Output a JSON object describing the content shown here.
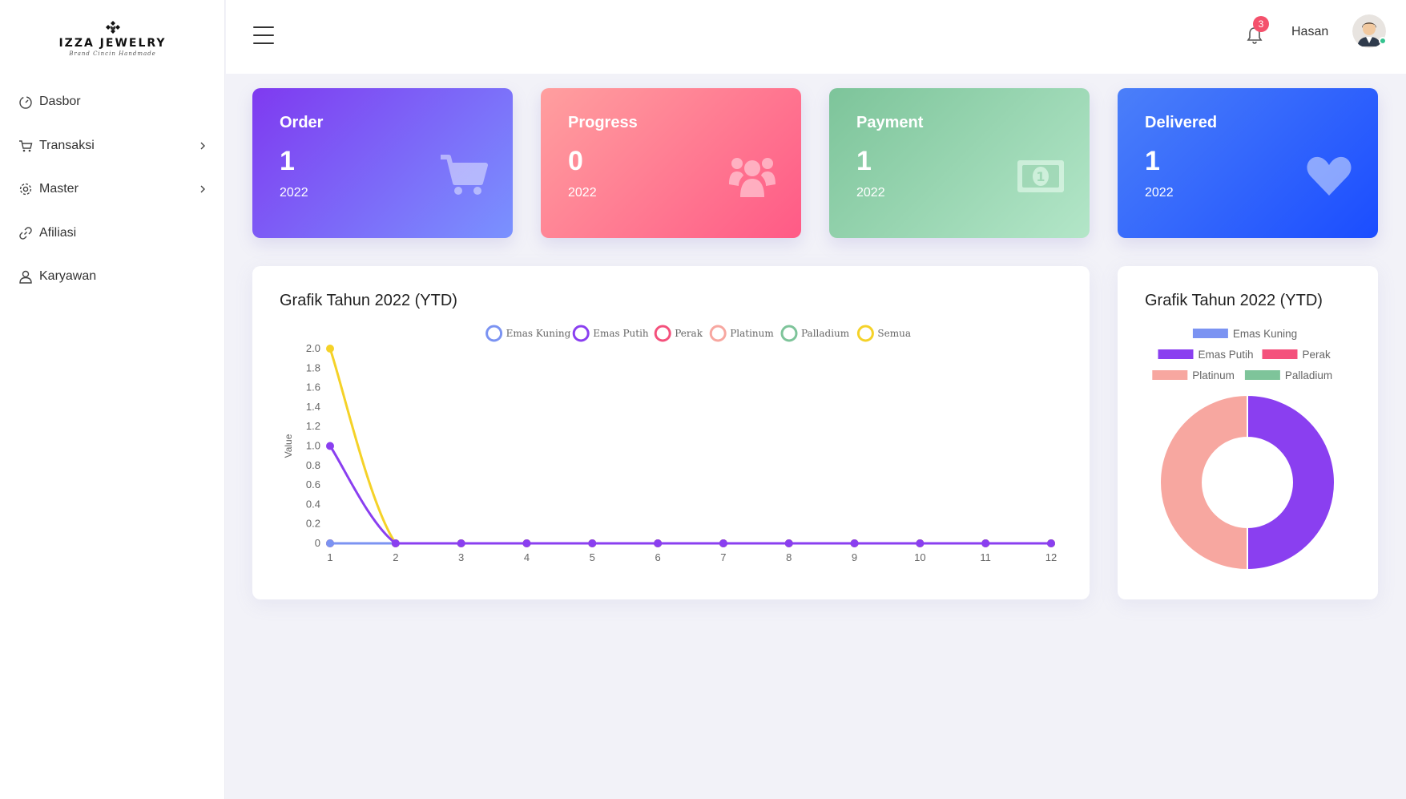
{
  "brand": {
    "name": "IZZA JEWELRY",
    "tagline": "Brand Cincin Handmade"
  },
  "sidebar": {
    "items": [
      {
        "label": "Dasbor",
        "icon": "dashboard-icon",
        "has_submenu": false
      },
      {
        "label": "Transaksi",
        "icon": "cart-icon",
        "has_submenu": true
      },
      {
        "label": "Master",
        "icon": "gear-icon",
        "has_submenu": true
      },
      {
        "label": "Afiliasi",
        "icon": "link-icon",
        "has_submenu": false
      },
      {
        "label": "Karyawan",
        "icon": "user-icon",
        "has_submenu": false
      }
    ]
  },
  "header": {
    "notification_count": "3",
    "username": "Hasan"
  },
  "cards": [
    {
      "title": "Order",
      "value": "1",
      "year": "2022",
      "icon": "cart-icon",
      "color_from": "#7f3af0",
      "color_to": "#7a92ff"
    },
    {
      "title": "Progress",
      "value": "0",
      "year": "2022",
      "icon": "users-icon",
      "color_from": "#ff9f9f",
      "color_to": "#ff5a86"
    },
    {
      "title": "Payment",
      "value": "1",
      "year": "2022",
      "icon": "money-icon",
      "color_from": "#7dc49a",
      "color_to": "#b3e6c8"
    },
    {
      "title": "Delivered",
      "value": "1",
      "year": "2022",
      "icon": "heart-icon",
      "color_from": "#4b7ff9",
      "color_to": "#1b4dff"
    }
  ],
  "line_panel": {
    "title": "Grafik Tahun 2022 (YTD)"
  },
  "donut_panel": {
    "title": "Grafik Tahun 2022 (YTD)"
  },
  "chart_data": [
    {
      "type": "line",
      "title": "Grafik Tahun 2022 (YTD)",
      "xlabel": "",
      "ylabel": "Value",
      "x": [
        1,
        2,
        3,
        4,
        5,
        6,
        7,
        8,
        9,
        10,
        11,
        12
      ],
      "ylim": [
        0,
        2.0
      ],
      "yticks": [
        "0",
        "0.2",
        "0.4",
        "0.6",
        "0.8",
        "1.0",
        "1.2",
        "1.4",
        "1.6",
        "1.8",
        "2.0"
      ],
      "legend_position": "top",
      "series": [
        {
          "name": "Emas Kuning",
          "color": "#7b93f2",
          "values": [
            0,
            0,
            0,
            0,
            0,
            0,
            0,
            0,
            0,
            0,
            0,
            0
          ]
        },
        {
          "name": "Emas Putih",
          "color": "#8a3ff0",
          "values": [
            1,
            0,
            0,
            0,
            0,
            0,
            0,
            0,
            0,
            0,
            0,
            0
          ]
        },
        {
          "name": "Perak",
          "color": "#f4517c",
          "values": [
            0,
            0,
            0,
            0,
            0,
            0,
            0,
            0,
            0,
            0,
            0,
            0
          ]
        },
        {
          "name": "Platinum",
          "color": "#f7a7a0",
          "values": [
            0,
            0,
            0,
            0,
            0,
            0,
            0,
            0,
            0,
            0,
            0,
            0
          ]
        },
        {
          "name": "Palladium",
          "color": "#7ec49a",
          "values": [
            0,
            0,
            0,
            0,
            0,
            0,
            0,
            0,
            0,
            0,
            0,
            0
          ]
        },
        {
          "name": "Semua",
          "color": "#f5d228",
          "values": [
            2,
            0,
            0,
            0,
            0,
            0,
            0,
            0,
            0,
            0,
            0,
            0
          ]
        }
      ]
    },
    {
      "type": "pie",
      "title": "Grafik Tahun 2022 (YTD)",
      "legend_position": "top",
      "series": [
        {
          "name": "Emas Kuning",
          "color": "#7b93f2",
          "value": 0
        },
        {
          "name": "Emas Putih",
          "color": "#8a3ff0",
          "value": 1
        },
        {
          "name": "Perak",
          "color": "#f4517c",
          "value": 0
        },
        {
          "name": "Platinum",
          "color": "#f7a7a0",
          "value": 1
        },
        {
          "name": "Palladium",
          "color": "#7ec49a",
          "value": 0
        }
      ]
    }
  ]
}
